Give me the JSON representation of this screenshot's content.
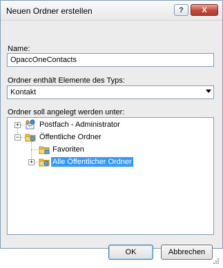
{
  "dialog": {
    "title": "Neuen Ordner erstellen",
    "help_button": "?",
    "close_button": "X"
  },
  "form": {
    "name_label": "Name:",
    "name_value": "OpaccOneContacts",
    "type_label": "Ordner enthält Elemente des Typs:",
    "type_value": "Kontakt",
    "location_label": "Ordner soll angelegt werden unter:"
  },
  "tree": {
    "items": [
      {
        "label": "Postfach - Administrator",
        "expander": "+"
      },
      {
        "label": "Öffentliche Ordner",
        "expander": "−"
      },
      {
        "label": "Favoriten"
      },
      {
        "label": "Alle Öffentlicher Ordner",
        "expander": "+",
        "selected": true
      }
    ]
  },
  "buttons": {
    "ok": "OK",
    "cancel": "Abbrechen"
  }
}
